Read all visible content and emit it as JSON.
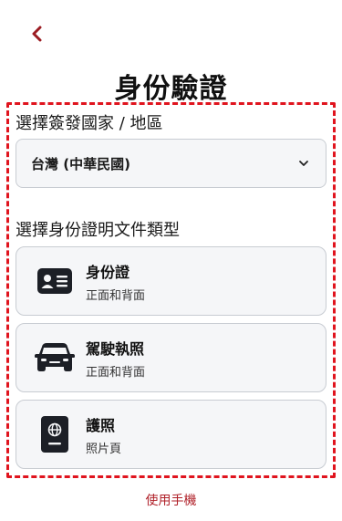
{
  "header": {
    "back_icon": "chevron-left-icon",
    "title": "身份驗證"
  },
  "country_section": {
    "label": "選擇簽發國家 / 地區",
    "selected_value": "台灣 (中華民國)",
    "dropdown_icon": "chevron-down-icon"
  },
  "document_section": {
    "label": "選擇身份證明文件類型",
    "options": [
      {
        "icon": "id-card-icon",
        "title": "身份證",
        "subtitle": "正面和背面"
      },
      {
        "icon": "car-icon",
        "title": "駕駛執照",
        "subtitle": "正面和背面"
      },
      {
        "icon": "passport-icon",
        "title": "護照",
        "subtitle": "照片頁"
      }
    ]
  },
  "footer": {
    "link_label": "使用手機"
  },
  "colors": {
    "accent": "#b0222a",
    "highlight_border": "#e0141e",
    "card_bg": "#f5f6f8",
    "card_border": "#c8ccd2"
  }
}
